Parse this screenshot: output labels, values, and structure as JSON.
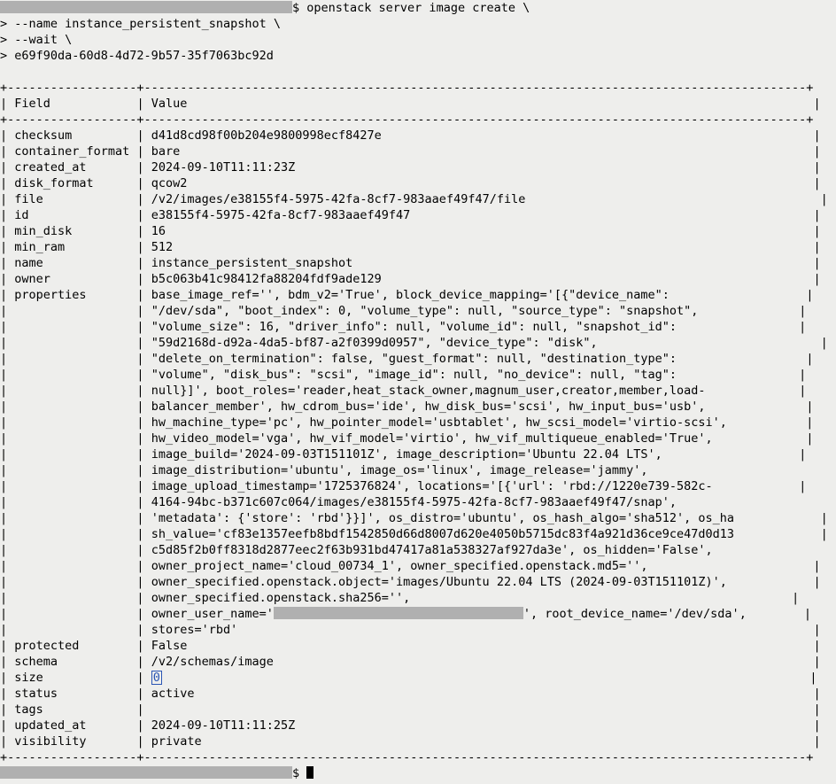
{
  "prompt_suffix": "$ ",
  "command": {
    "line1": "openstack server image create \\",
    "line2": "> --name instance_persistent_snapshot \\",
    "line3": "> --wait \\",
    "line4": "> e69f90da-60d8-4d72-9b57-35f7063bc92d"
  },
  "table": {
    "header_field": "Field",
    "header_value": "Value",
    "border_top": "+------------------+--------------------------------------------------------------------------------------------+",
    "border_mid": "+------------------+--------------------------------------------------------------------------------------------+",
    "border_bot": "+------------------+--------------------------------------------------------------------------------------------+",
    "rows": {
      "checksum": {
        "field": "checksum",
        "value": "d41d8cd98f00b204e9800998ecf8427e"
      },
      "container_format": {
        "field": "container_format",
        "value": "bare"
      },
      "created_at": {
        "field": "created_at",
        "value": "2024-09-10T11:11:23Z"
      },
      "disk_format": {
        "field": "disk_format",
        "value": "qcow2"
      },
      "file": {
        "field": "file",
        "value": "/v2/images/e38155f4-5975-42fa-8cf7-983aaef49f47/file"
      },
      "id": {
        "field": "id",
        "value": "e38155f4-5975-42fa-8cf7-983aaef49f47"
      },
      "min_disk": {
        "field": "min_disk",
        "value": "16"
      },
      "min_ram": {
        "field": "min_ram",
        "value": "512"
      },
      "name": {
        "field": "name",
        "value": "instance_persistent_snapshot"
      },
      "owner": {
        "field": "owner",
        "value": "b5c063b41c98412fa88204fdf9ade129"
      },
      "properties": {
        "field": "properties",
        "lines": [
          "base_image_ref='', bdm_v2='True', block_device_mapping='[{\"device_name\":",
          "\"/dev/sda\", \"boot_index\": 0, \"volume_type\": null, \"source_type\": \"snapshot\",",
          "\"volume_size\": 16, \"driver_info\": null, \"volume_id\": null, \"snapshot_id\":",
          "\"59d2168d-d92a-4da5-bf87-a2f0399d0957\", \"device_type\": \"disk\",",
          "\"delete_on_termination\": false, \"guest_format\": null, \"destination_type\":",
          "\"volume\", \"disk_bus\": \"scsi\", \"image_id\": null, \"no_device\": null, \"tag\":",
          "null}]', boot_roles='reader,heat_stack_owner,magnum_user,creator,member,load-",
          "balancer_member', hw_cdrom_bus='ide', hw_disk_bus='scsi', hw_input_bus='usb',",
          "hw_machine_type='pc', hw_pointer_model='usbtablet', hw_scsi_model='virtio-scsi',",
          "hw_video_model='vga', hw_vif_model='virtio', hw_vif_multiqueue_enabled='True',",
          "image_build='2024-09-03T151101Z', image_description='Ubuntu 22.04 LTS',",
          "image_distribution='ubuntu', image_os='linux', image_release='jammy',",
          "image_upload_timestamp='1725376824', locations='[{'url': 'rbd://1220e739-582c-",
          "4164-94bc-b371c607c064/images/e38155f4-5975-42fa-8cf7-983aaef49f47/snap',",
          "'metadata': {'store': 'rbd'}}]', os_distro='ubuntu', os_hash_algo='sha512', os_ha",
          "sh_value='cf83e1357eefb8bdf1542850d66d8007d620e4050b5715dc83f4a921d36ce9ce47d0d13",
          "c5d85f2b0ff8318d2877eec2f63b931bd47417a81a538327af927da3e', os_hidden='False',",
          "owner_project_name='cloud_00734_1', owner_specified.openstack.md5='',",
          "owner_specified.openstack.object='images/Ubuntu 22.04 LTS (2024-09-03T151101Z)',",
          "owner_specified.openstack.sha256='',"
        ],
        "owner_user_prefix": "owner_user_name='",
        "owner_user_suffix": "', root_device_name='/dev/sda',",
        "last_line": "stores='rbd'"
      },
      "protected": {
        "field": "protected",
        "value": "False"
      },
      "schema": {
        "field": "schema",
        "value": "/v2/schemas/image"
      },
      "size": {
        "field": "size",
        "value": "0"
      },
      "status": {
        "field": "status",
        "value": "active"
      },
      "tags": {
        "field": "tags",
        "value": ""
      },
      "updated_at": {
        "field": "updated_at",
        "value": "2024-09-10T11:11:25Z"
      },
      "visibility": {
        "field": "visibility",
        "value": "private"
      }
    }
  }
}
